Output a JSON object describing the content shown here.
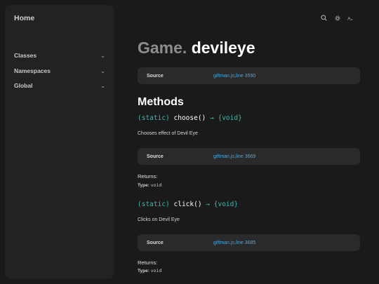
{
  "sidebar": {
    "home": "Home",
    "items": [
      {
        "label": "Classes",
        "chevron": "⌄"
      },
      {
        "label": "Namespaces",
        "chevron": "⌄"
      },
      {
        "label": "Global",
        "chevron": "⌄"
      }
    ]
  },
  "toolbar": {
    "icons": [
      "search-icon",
      "gear-icon",
      "font-size-icon"
    ]
  },
  "header": {
    "namespace": "Game.",
    "name": "devileye"
  },
  "source_box": {
    "label": "Source",
    "link": "giftman.js,line 3590"
  },
  "methods": {
    "heading": "Methods",
    "items": [
      {
        "static": "(static)",
        "name": "choose()",
        "arrow": "→",
        "returns": "{void}",
        "description": "Chooses effect of Devil Eye",
        "source_label": "Source",
        "source_link": "giftman.js,line 3669",
        "returns_heading": "Returns:",
        "type_label": "Type:",
        "type_value": "void"
      },
      {
        "static": "(static)",
        "name": "click()",
        "arrow": "→",
        "returns": "{void}",
        "description": "Clicks on Devil Eye",
        "source_label": "Source",
        "source_link": "giftman.js,line 3685",
        "returns_heading": "Returns:",
        "type_label": "Type:",
        "type_value": "void"
      }
    ]
  },
  "colors": {
    "background": "#1a1a1a",
    "panel": "#222222",
    "accent": "#3fb8b0",
    "link": "#4aa8e0"
  }
}
